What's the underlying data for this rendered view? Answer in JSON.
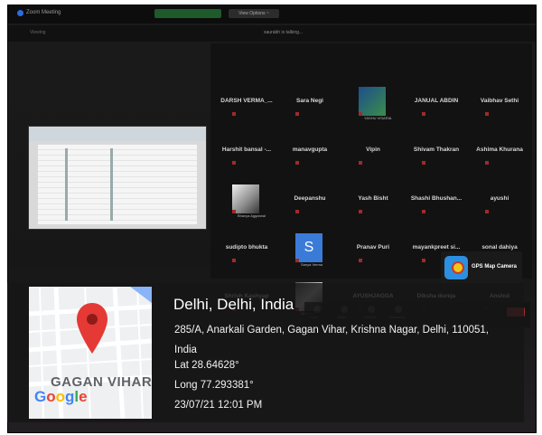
{
  "zoom": {
    "app_title": "Zoom Meeting",
    "view_label": "View Options ~",
    "talking": "saurabh is talking...",
    "share_left": "Viewing",
    "participants": [
      {
        "name": "DARSH VERMA_..."
      },
      {
        "name": "Sara Negi"
      },
      {
        "name": "",
        "caption": "YASHU VISARIA",
        "avatar": "photo"
      },
      {
        "name": "JANUAL ABDIN"
      },
      {
        "name": "Vaibhav Sethi"
      },
      {
        "name": "Harshit bansal -..."
      },
      {
        "name": "manavgupta"
      },
      {
        "name": "Vipin"
      },
      {
        "name": "Shivam Thakran"
      },
      {
        "name": "Ashima Khurana"
      },
      {
        "name": "",
        "caption": "Bhavya Aggarwal",
        "avatar": "photo"
      },
      {
        "name": "Deepanshu"
      },
      {
        "name": "Yash Bisht"
      },
      {
        "name": "Shashi Bhushan..."
      },
      {
        "name": "ayushi"
      },
      {
        "name": "sudipto bhukta"
      },
      {
        "name": "",
        "caption": "Sanya Verma",
        "avatar": "S"
      },
      {
        "name": "Pranav Puri"
      },
      {
        "name": "mayankpreet si..."
      },
      {
        "name": "sonal dahiya"
      },
      {
        "name": "Shrish Kashyap"
      },
      {
        "name": "",
        "caption": "Sanya...",
        "avatar": "photo"
      },
      {
        "name": "AYUSHJAGGA"
      },
      {
        "name": "Diksha dureja"
      },
      {
        "name": "Anshul"
      }
    ],
    "controls": [
      "Chat",
      "Share",
      "Record",
      "Reactions"
    ]
  },
  "gps": {
    "badge_label": "GPS Map Camera",
    "title": "Delhi, Delhi, India",
    "address": "285/A, Anarkali Garden, Gagan Vihar, Krishna Nagar, Delhi, 110051, India",
    "lat": "Lat 28.64628°",
    "long": "Long 77.293381°",
    "datetime": "23/07/21 12:01 PM"
  },
  "map": {
    "area_label": "GAGAN VIHAR",
    "logo": {
      "g1": "G",
      "o1": "o",
      "o2": "o",
      "g2": "g",
      "l": "l",
      "e": "e"
    }
  },
  "colors": {
    "pin": "#e53935",
    "overlay": "#161616",
    "map_bg": "#eef0f1"
  }
}
